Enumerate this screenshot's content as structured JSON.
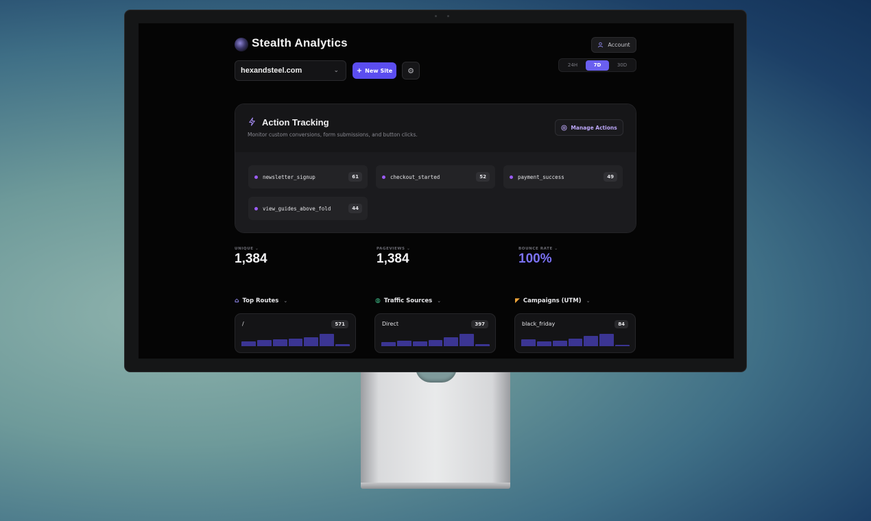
{
  "app": {
    "title": "Stealth Analytics",
    "account_label": "Account",
    "site": "hexandsteel.com",
    "new_site_label": "New Site",
    "time_ranges": [
      "24H",
      "7D",
      "30D"
    ],
    "active_range": "7D"
  },
  "action_tracking": {
    "title": "Action Tracking",
    "subtitle": "Monitor custom conversions, form submissions, and button clicks.",
    "manage_label": "Manage Actions",
    "actions": [
      {
        "name": "newsletter_signup",
        "count": "61"
      },
      {
        "name": "checkout_started",
        "count": "52"
      },
      {
        "name": "payment_success",
        "count": "49"
      },
      {
        "name": "view_guides_above_fold",
        "count": "44"
      }
    ]
  },
  "stats": [
    {
      "label": "UNIQUE",
      "value": "1,384"
    },
    {
      "label": "PAGEVIEWS",
      "value": "1,384"
    },
    {
      "label": "BOUNCE RATE",
      "value": "100%"
    }
  ],
  "sections": [
    {
      "title": "Top Routes",
      "icon": "home-icon",
      "item": "/",
      "count": "571",
      "bars": [
        0.4,
        0.5,
        0.55,
        0.6,
        0.75,
        1.0,
        0.15
      ]
    },
    {
      "title": "Traffic Sources",
      "icon": "globe-icon",
      "item": "Direct",
      "count": "397",
      "bars": [
        0.35,
        0.45,
        0.4,
        0.5,
        0.7,
        1.0,
        0.15
      ]
    },
    {
      "title": "Campaigns (UTM)",
      "icon": "megaphone-icon",
      "item": "black_friday",
      "count": "84",
      "bars": [
        0.55,
        0.4,
        0.45,
        0.6,
        0.85,
        1.0,
        0.1
      ]
    }
  ],
  "colors": {
    "accent": "#5b4df0",
    "accent_text": "#7b72f5",
    "chip_dot": "#9b5cf6",
    "bar": "#3b3593"
  }
}
